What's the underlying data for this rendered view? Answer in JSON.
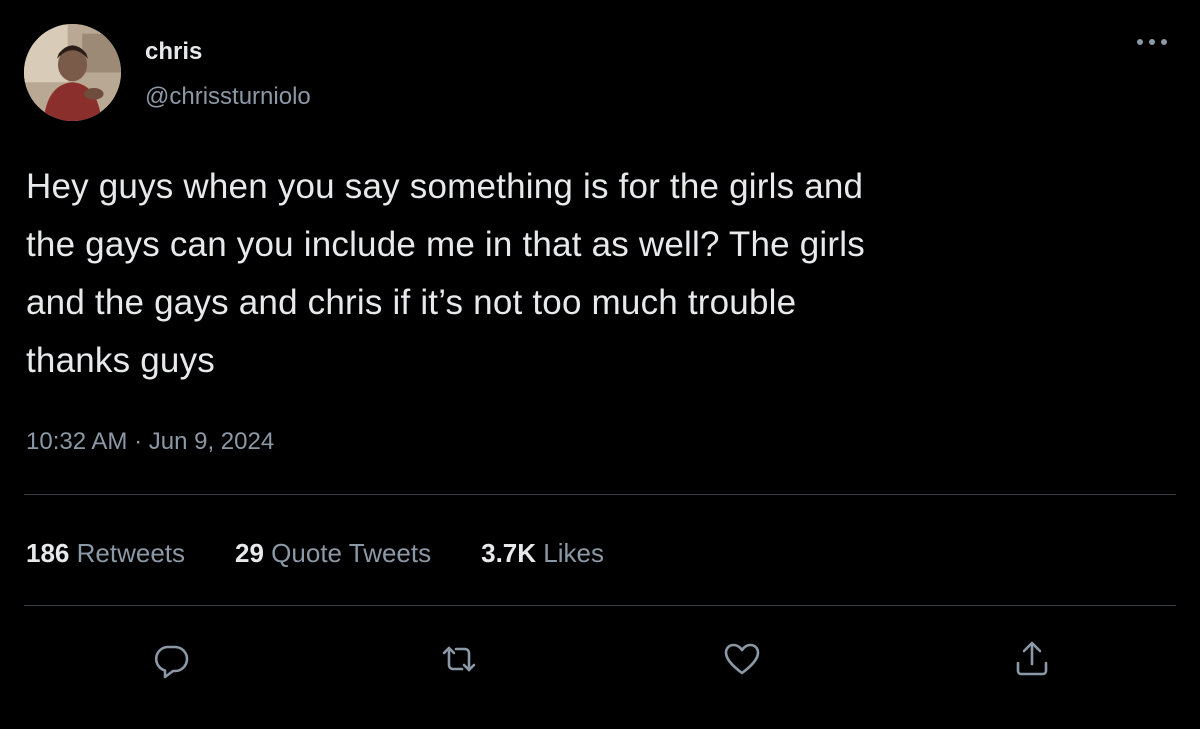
{
  "user": {
    "display_name": "chris",
    "handle": "@chrissturniolo"
  },
  "tweet": {
    "text": "Hey guys when you say something is for the girls and\nthe gays can you include me in that as well? The girls\nand the gays and chris if it’s not too much trouble\nthanks guys",
    "time": "10:32 AM · Jun 9, 2024"
  },
  "stats": {
    "retweets_count": "186",
    "retweets_label": "Retweets",
    "quotes_count": "29",
    "quotes_label": "Quote Tweets",
    "likes_count": "3.7K",
    "likes_label": "Likes"
  },
  "icons": {
    "more": "more-horizontal-icon",
    "reply": "reply-bubble-icon",
    "retweet": "retweet-arrows-icon",
    "like": "heart-icon",
    "share": "share-upload-icon"
  },
  "colors": {
    "background": "#000000",
    "primary_text": "#e7e9ea",
    "secondary_text": "#8b98a5",
    "divider": "#3a3f44"
  }
}
